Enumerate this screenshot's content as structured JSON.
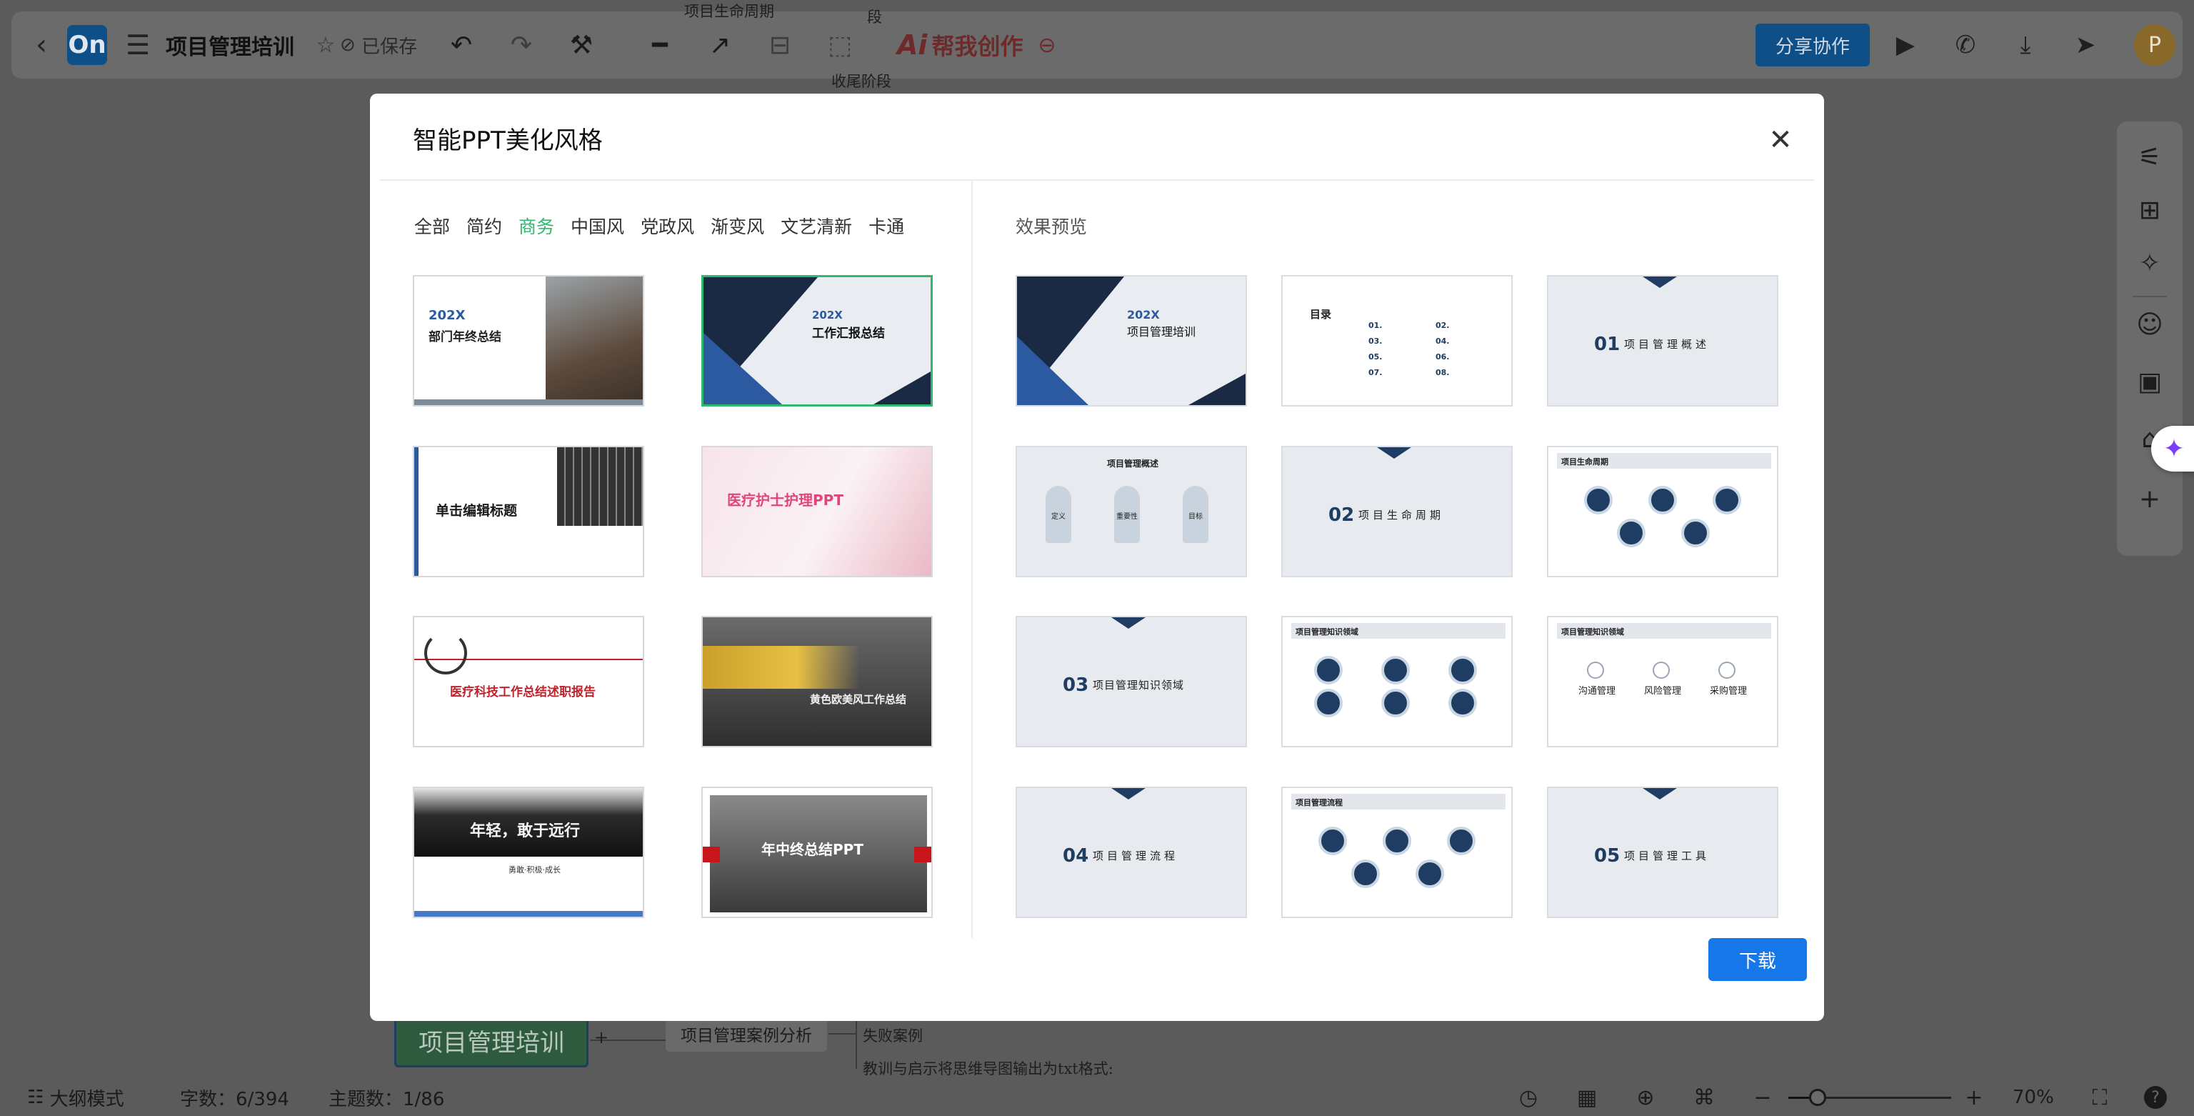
{
  "app": {
    "title": "项目管理培训",
    "saved": "已保存",
    "logo_text": "On",
    "ai_badge": "Ai",
    "ai_label": "帮我创作",
    "share_button": "分享协作",
    "avatar_letter": "P",
    "icons": {
      "back": "back-chevron-icon",
      "menu": "hamburger-menu-icon",
      "star": "star-icon",
      "saved": "cloud-saved-icon",
      "undo": "undo-icon",
      "redo": "redo-icon",
      "format_painter": "format-painter-icon",
      "line_style": "line-style-icon",
      "arrow": "arrow-icon",
      "layout": "layout-icon",
      "frame": "frame-select-icon",
      "more": "more-icon",
      "present": "present-icon",
      "phone": "phone-icon",
      "download": "download-icon",
      "send": "send-icon"
    }
  },
  "mindmap": {
    "root_node": "项目管理培训",
    "case_node": "项目管理案例分析",
    "child_failure": "失败案例",
    "child_lessons": "教训与启示将思维导图输出为txt格式:",
    "fragment_top1": "项目生命周期",
    "fragment_top2": "收尾阶段",
    "fragment_top3": "段"
  },
  "right_toolbar": [
    "style-settings-icon",
    "structure-icon",
    "magic-icon",
    "emoji-icon",
    "image-icon",
    "tag-icon",
    "add-icon"
  ],
  "statusbar": {
    "outline_mode": "大纲模式",
    "word_count": "字数：6/394",
    "topic_count": "主题数：1/86",
    "zoom": "70%",
    "zoom_fraction": 0.18,
    "help": "?"
  },
  "modal": {
    "title": "智能PPT美化风格",
    "filters": [
      "全部",
      "简约",
      "商务",
      "中国风",
      "党政风",
      "渐变风",
      "文艺清新",
      "卡通"
    ],
    "active_filter": "商务",
    "preview_label": "效果预览",
    "download_label": "下载",
    "templates": [
      {
        "title": "部门年终总结",
        "year": "202X",
        "selected": false
      },
      {
        "title": "工作汇报总结",
        "year": "202X",
        "selected": true
      },
      {
        "title": "单击编辑标题",
        "year": "",
        "selected": false
      },
      {
        "title": "医疗护士护理PPT",
        "year": "",
        "selected": false
      },
      {
        "title": "医疗科技工作总结述职报告",
        "year": "",
        "selected": false
      },
      {
        "title": "黄色欧美风工作总结",
        "year": "",
        "selected": false
      },
      {
        "title": "年轻，敢于远行",
        "year": "",
        "sub": "勇敢·积极·成长",
        "selected": false
      },
      {
        "title": "年中终总结PPT",
        "year": "",
        "selected": false
      }
    ],
    "previews": [
      {
        "kind": "cover",
        "year": "202X",
        "title": "项目管理培训"
      },
      {
        "kind": "toc",
        "title": "目录",
        "nums": [
          "01.",
          "02.",
          "03.",
          "04.",
          "05.",
          "06.",
          "07.",
          "08."
        ]
      },
      {
        "kind": "section",
        "num": "01",
        "title": "项目管理概述"
      },
      {
        "kind": "rockets",
        "title": "项目管理概述",
        "labels": [
          "定义",
          "重要性",
          "目标"
        ]
      },
      {
        "kind": "section",
        "num": "02",
        "title": "项目生命周期"
      },
      {
        "kind": "circles",
        "title": "项目生命周期",
        "count": 5
      },
      {
        "kind": "section",
        "num": "03",
        "title": "项目管理知识领域"
      },
      {
        "kind": "circles6",
        "title": "项目管理知识领域",
        "count": 6
      },
      {
        "kind": "three",
        "title": "项目管理知识领域",
        "labels": [
          "沟通管理",
          "风险管理",
          "采购管理"
        ]
      },
      {
        "kind": "section",
        "num": "04",
        "title": "项目管理流程"
      },
      {
        "kind": "circles",
        "title": "项目管理流程",
        "count": 5
      },
      {
        "kind": "section",
        "num": "05",
        "title": "项目管理工具"
      }
    ]
  },
  "colors": {
    "accent_green": "#2fb86e",
    "download_blue": "#1677e8",
    "navy": "#1f3d62"
  }
}
